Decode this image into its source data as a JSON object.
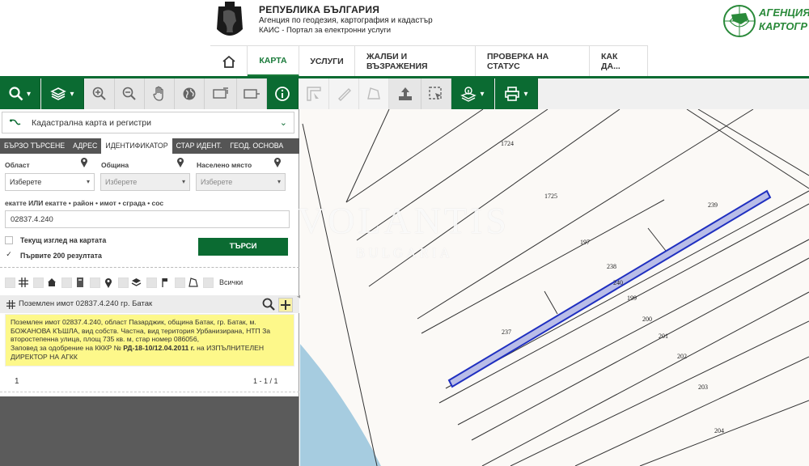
{
  "header": {
    "title": "РЕПУБЛИКА БЪЛГАРИЯ",
    "subtitle1": "Агенция по геодезия, картография и кадастър",
    "subtitle2": "КАИС - Портал за електронни услуги",
    "agency_line1": "АГЕНЦИЯ",
    "agency_line2": "КАРТОГР"
  },
  "nav": {
    "items": [
      {
        "label": "КАРТА",
        "active": true
      },
      {
        "label": "УСЛУГИ"
      },
      {
        "label": "ЖАЛБИ И ВЪЗРАЖЕНИЯ"
      },
      {
        "label": "ПРОВЕРКА НА СТАТУС"
      },
      {
        "label": "КАК ДА..."
      }
    ]
  },
  "panel": {
    "layer_select": "Кадастрална карта и регистри",
    "tabs": [
      "БЪРЗО ТЪРСЕНЕ",
      "АДРЕС",
      "ИДЕНТИФИКАТОР",
      "СТАР ИДЕНТ.",
      "ГЕОД. ОСНОВА"
    ],
    "labels": {
      "oblast": "Област",
      "obshtina": "Община",
      "naseleno": "Населено място",
      "ekatte": "екатте ИЛИ екатте • район • имот • сграда • сос"
    },
    "selects": {
      "oblast": "Изберете",
      "obshtina": "Изберете",
      "naseleno": "Изберете"
    },
    "search_value": "02837.4.240",
    "check_current_view": "Текущ изглед на картата",
    "check_first_200": "Първите 200 резултата",
    "search_button": "ТЪРСИ",
    "filter_all": "Всички",
    "result_title": "Поземлен имот 02837.4.240 гр. Батак",
    "result_text_1": "Поземлен имот 02837.4.240, област Пазарджик, община Батак, гр. Батак, м. БОЖАНОВА КЪШЛА, вид собств. Частна, вид територия Урбанизирана, НТП За второстепенна улица, площ 735 кв. м, стар номер 086056,",
    "result_text_2a": "Заповед за одобрение на КККР № ",
    "result_text_2b": "РД-18-10/12.04.2011 г.",
    "result_text_2c": " на ИЗПЪЛНИТЕЛЕН ДИРЕКТОР НА АГКК",
    "pager_page": "1",
    "pager_count": "1 - 1 / 1"
  },
  "map": {
    "parcel_labels": [
      "1724",
      "1725",
      "239",
      "197",
      "238",
      "240",
      "199",
      "200",
      "201",
      "202",
      "237",
      "203",
      "204"
    ],
    "highlight_color": "#1f2fc0"
  },
  "watermark": {
    "line1": "VOLANTIS",
    "line2": "BULGARIA"
  }
}
